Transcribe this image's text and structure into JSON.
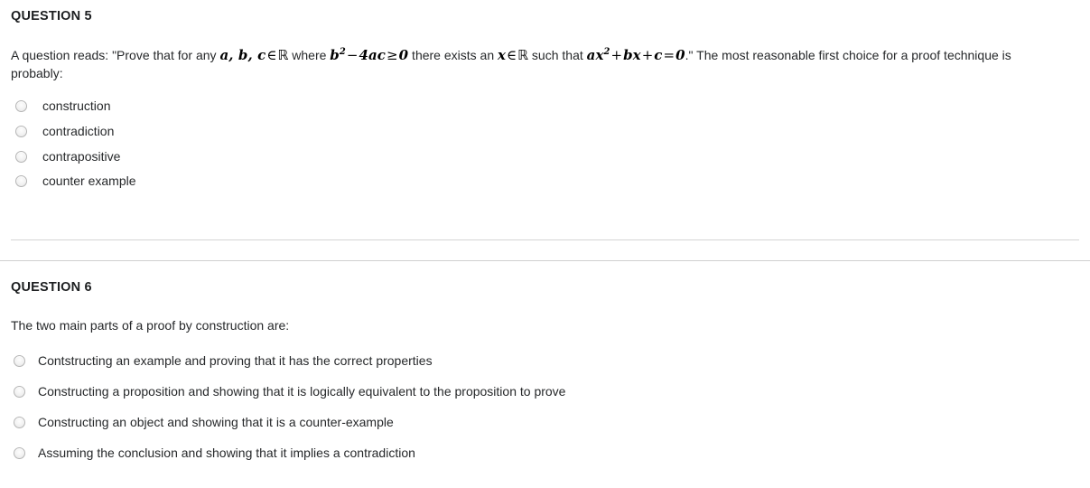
{
  "questions": [
    {
      "heading": "QUESTION 5",
      "prompt_prefix": "A question reads: \"Prove that for any ",
      "math1": "a, b, c",
      "math1_op": "∈",
      "math1_set": "ℝ",
      "prompt_mid1": " where ",
      "math2_base": "b",
      "math2_exp": "2",
      "math2_minus": "−",
      "math2_term": "4ac",
      "math2_rel": "≥",
      "math2_zero": "0",
      "prompt_mid2": " there exists an ",
      "math3_var": "x",
      "math3_op": "∈",
      "math3_set": "ℝ",
      "prompt_mid3": " such that ",
      "math4_a": "ax",
      "math4_exp": "2",
      "math4_plus1": "+",
      "math4_bx": "bx",
      "math4_plus2": "+",
      "math4_c": "c",
      "math4_eq": "=",
      "math4_zero": "0",
      "prompt_suffix": ".\" The most reasonable first choice for a proof technique is probably:",
      "options": [
        "construction",
        "contradiction",
        "contrapositive",
        "counter example"
      ]
    },
    {
      "heading": "QUESTION 6",
      "prompt": "The two main parts of a proof by construction are:",
      "options": [
        "Contstructing an example and proving that it has the correct properties",
        "Constructing a proposition and showing that it is logically equivalent to the proposition to prove",
        "Constructing an object and showing that it is a counter-example",
        "Assuming the conclusion and showing that it implies a contradiction"
      ]
    }
  ],
  "colors": {
    "text": "#26282a",
    "heading": "#1d1f21",
    "divider": "#d4d4d4",
    "radio_border": "#b5b5b5",
    "background": "#ffffff"
  }
}
